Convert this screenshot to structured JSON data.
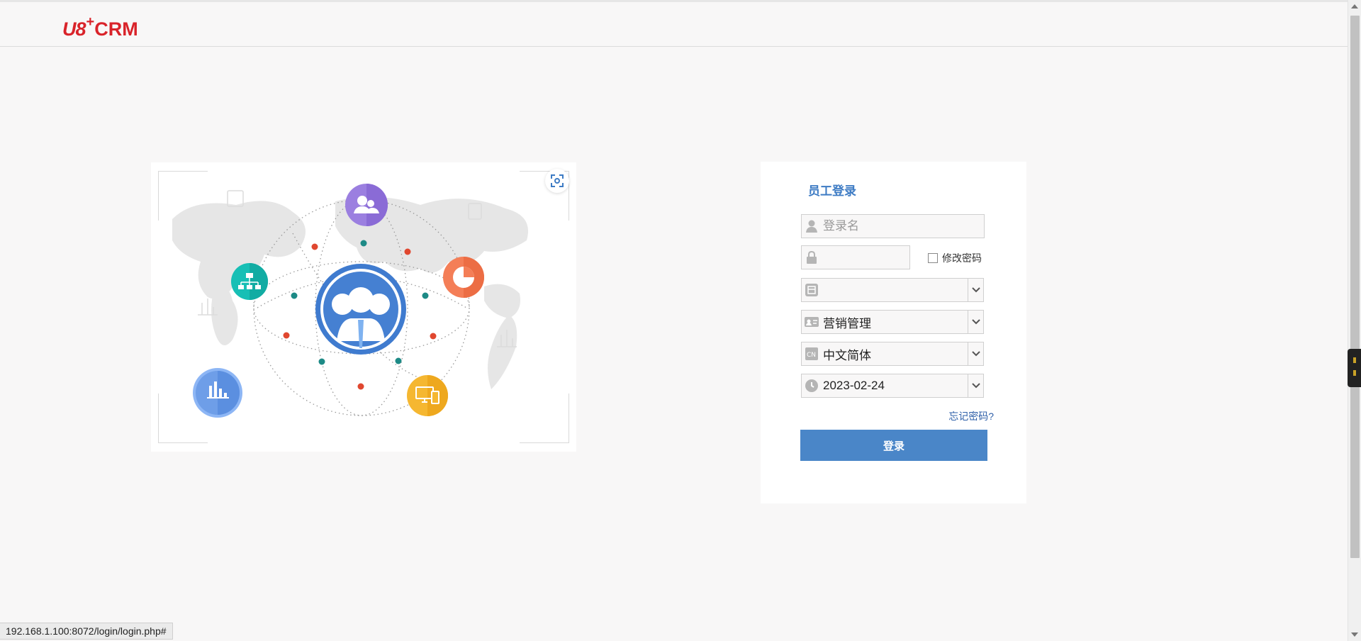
{
  "header": {
    "logo_main": "U8",
    "logo_plus": "+",
    "logo_crm": "CRM"
  },
  "login": {
    "title": "员工登录",
    "username_placeholder": "登录名",
    "password_value": "",
    "change_password_label": "修改密码",
    "account_value": "",
    "role_value": "营销管理",
    "language_value": "中文简体",
    "date_value": "2023-02-24",
    "forgot_password": "忘记密码?",
    "submit_label": "登录"
  },
  "status": {
    "url": "192.168.1.100:8072/login/login.php#"
  },
  "colors": {
    "brand_red": "#d9232a",
    "accent_blue": "#4a86c8",
    "title_blue": "#3d7bc4"
  },
  "icons": {
    "user": "user-icon",
    "lock": "lock-icon",
    "account": "account-book-icon",
    "role": "id-card-icon",
    "language": "language-icon",
    "date": "clock-icon",
    "scan": "screenshot-scan-icon"
  }
}
